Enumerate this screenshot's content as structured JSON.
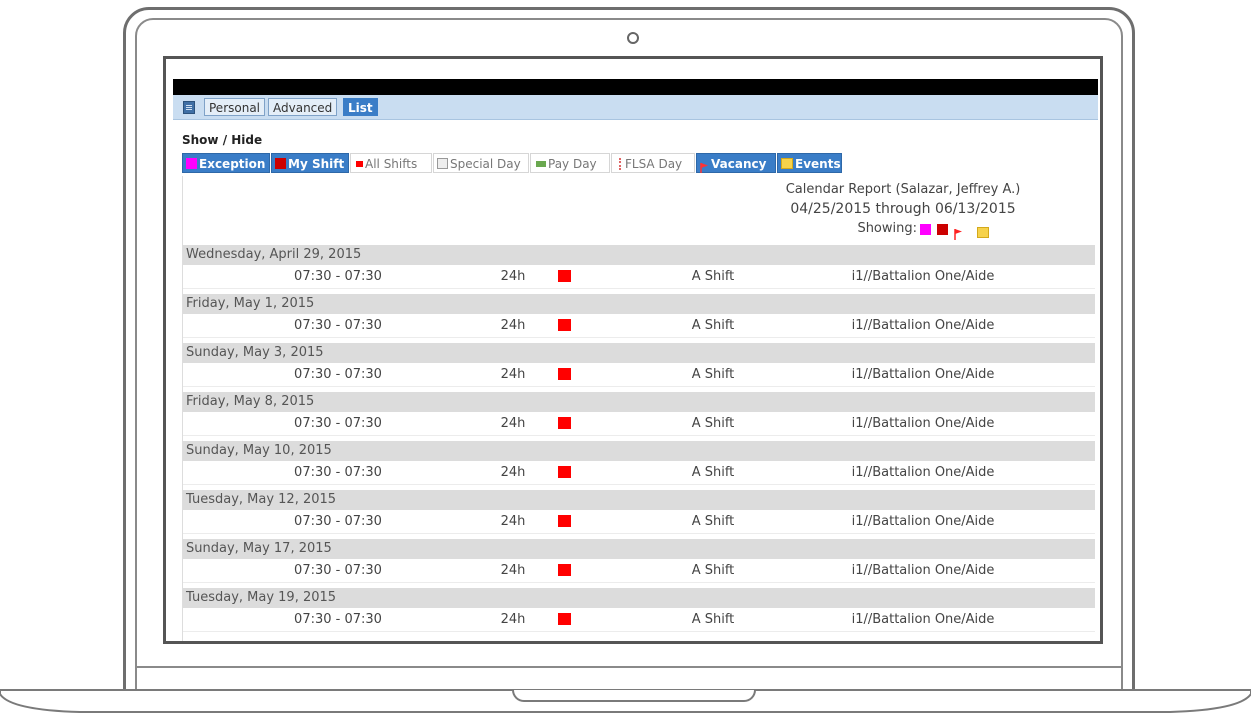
{
  "tabs": [
    {
      "label": "Personal",
      "active": false
    },
    {
      "label": "Advanced",
      "active": false
    },
    {
      "label": "List",
      "active": true
    }
  ],
  "show_hide_label": "Show / Hide",
  "filters": [
    {
      "label": "Exception",
      "on": true,
      "icon": "magenta-square-icon",
      "color": "#ff00ff"
    },
    {
      "label": "My Shift",
      "on": true,
      "icon": "darkred-square-icon",
      "color": "#cc0000"
    },
    {
      "label": "All Shifts",
      "on": false,
      "icon": "red-small-square-icon",
      "color": "#ff0000"
    },
    {
      "label": "Special Day",
      "on": false,
      "icon": "special-day-icon",
      "color": "#999999"
    },
    {
      "label": "Pay Day",
      "on": false,
      "icon": "money-icon",
      "color": "#6aa84f"
    },
    {
      "label": "FLSA Day",
      "on": false,
      "icon": "dashed-line-icon",
      "color": "#e06666"
    },
    {
      "label": "Vacancy",
      "on": true,
      "icon": "red-flag-icon",
      "color": "#ff0000"
    },
    {
      "label": "Events",
      "on": true,
      "icon": "note-icon",
      "color": "#f6d24b"
    }
  ],
  "report": {
    "title": "Calendar Report (Salazar, Jeffrey A.)",
    "date_range": "04/25/2015 through 06/13/2015",
    "showing_label": "Showing:",
    "showing_icons": [
      "magenta-square-icon",
      "darkred-square-icon",
      "red-flag-icon",
      "note-icon"
    ]
  },
  "entries": [
    {
      "date": "Wednesday, April 29, 2015",
      "time": "07:30 - 07:30",
      "hours": "24h",
      "shift": "A Shift",
      "assignment": "i1//Battalion One/Aide"
    },
    {
      "date": "Friday, May 1, 2015",
      "time": "07:30 - 07:30",
      "hours": "24h",
      "shift": "A Shift",
      "assignment": "i1//Battalion One/Aide"
    },
    {
      "date": "Sunday, May 3, 2015",
      "time": "07:30 - 07:30",
      "hours": "24h",
      "shift": "A Shift",
      "assignment": "i1//Battalion One/Aide"
    },
    {
      "date": "Friday, May 8, 2015",
      "time": "07:30 - 07:30",
      "hours": "24h",
      "shift": "A Shift",
      "assignment": "i1//Battalion One/Aide"
    },
    {
      "date": "Sunday, May 10, 2015",
      "time": "07:30 - 07:30",
      "hours": "24h",
      "shift": "A Shift",
      "assignment": "i1//Battalion One/Aide"
    },
    {
      "date": "Tuesday, May 12, 2015",
      "time": "07:30 - 07:30",
      "hours": "24h",
      "shift": "A Shift",
      "assignment": "i1//Battalion One/Aide"
    },
    {
      "date": "Sunday, May 17, 2015",
      "time": "07:30 - 07:30",
      "hours": "24h",
      "shift": "A Shift",
      "assignment": "i1//Battalion One/Aide"
    },
    {
      "date": "Tuesday, May 19, 2015",
      "time": "07:30 - 07:30",
      "hours": "24h",
      "shift": "A Shift",
      "assignment": "i1//Battalion One/Aide"
    }
  ]
}
